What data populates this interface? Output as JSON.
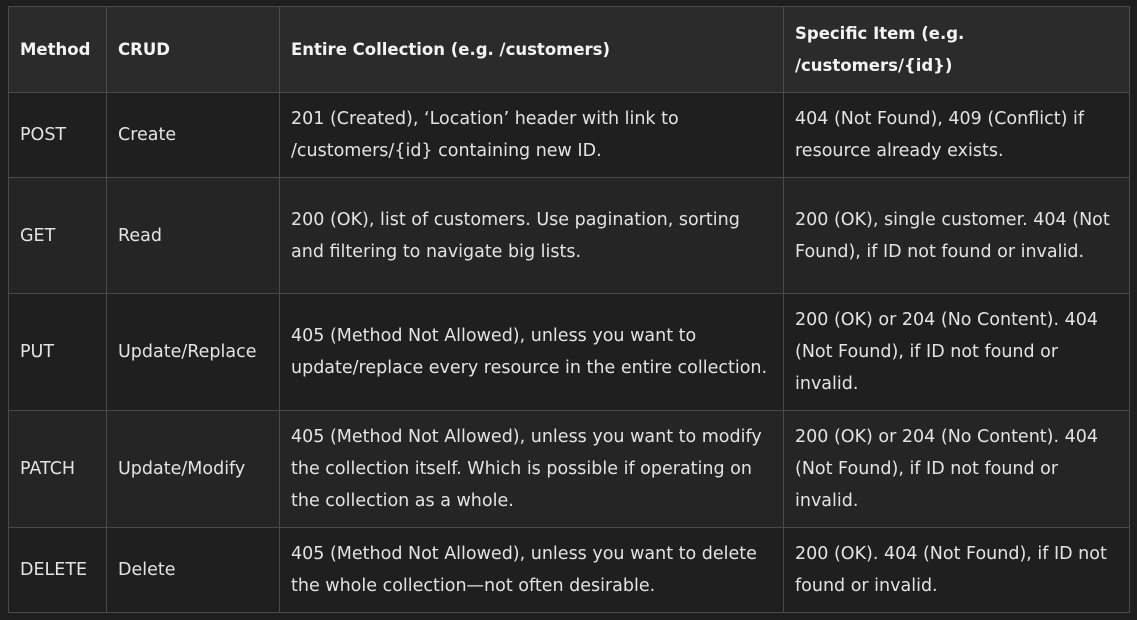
{
  "table": {
    "headers": {
      "method": "Method",
      "crud": "CRUD",
      "collection": "Entire Collection (e.g. /customers)",
      "item": "Specific Item (e.g. /customers/{id})"
    },
    "rows": [
      {
        "method": "POST",
        "crud": "Create",
        "collection": "201 (Created), ‘Location’ header with link to /customers/{id} containing new ID.",
        "item": "404 (Not Found), 409 (Conflict) if resource already exists."
      },
      {
        "method": "GET",
        "crud": "Read",
        "collection": "200 (OK), list of customers. Use pagination, sorting and filtering to navigate big lists.",
        "item": "200 (OK), single customer. 404 (Not Found), if ID not found or invalid."
      },
      {
        "method": "PUT",
        "crud": "Update/Replace",
        "collection": "405 (Method Not Allowed), unless you want to update/replace every resource in the entire collection.",
        "item": "200 (OK) or 204 (No Content). 404 (Not Found), if ID not found or invalid."
      },
      {
        "method": "PATCH",
        "crud": "Update/Modify",
        "collection": "405 (Method Not Allowed), unless you want to modify the collection itself. Which is possible if operating on the collection as a whole.",
        "item": "200 (OK) or 204 (No Content). 404 (Not Found), if ID not found or invalid."
      },
      {
        "method": "DELETE",
        "crud": "Delete",
        "collection": "405 (Method Not Allowed), unless you want to delete the whole collection—not often desirable.",
        "item": "200 (OK). 404 (Not Found), if ID not found or invalid."
      }
    ]
  }
}
